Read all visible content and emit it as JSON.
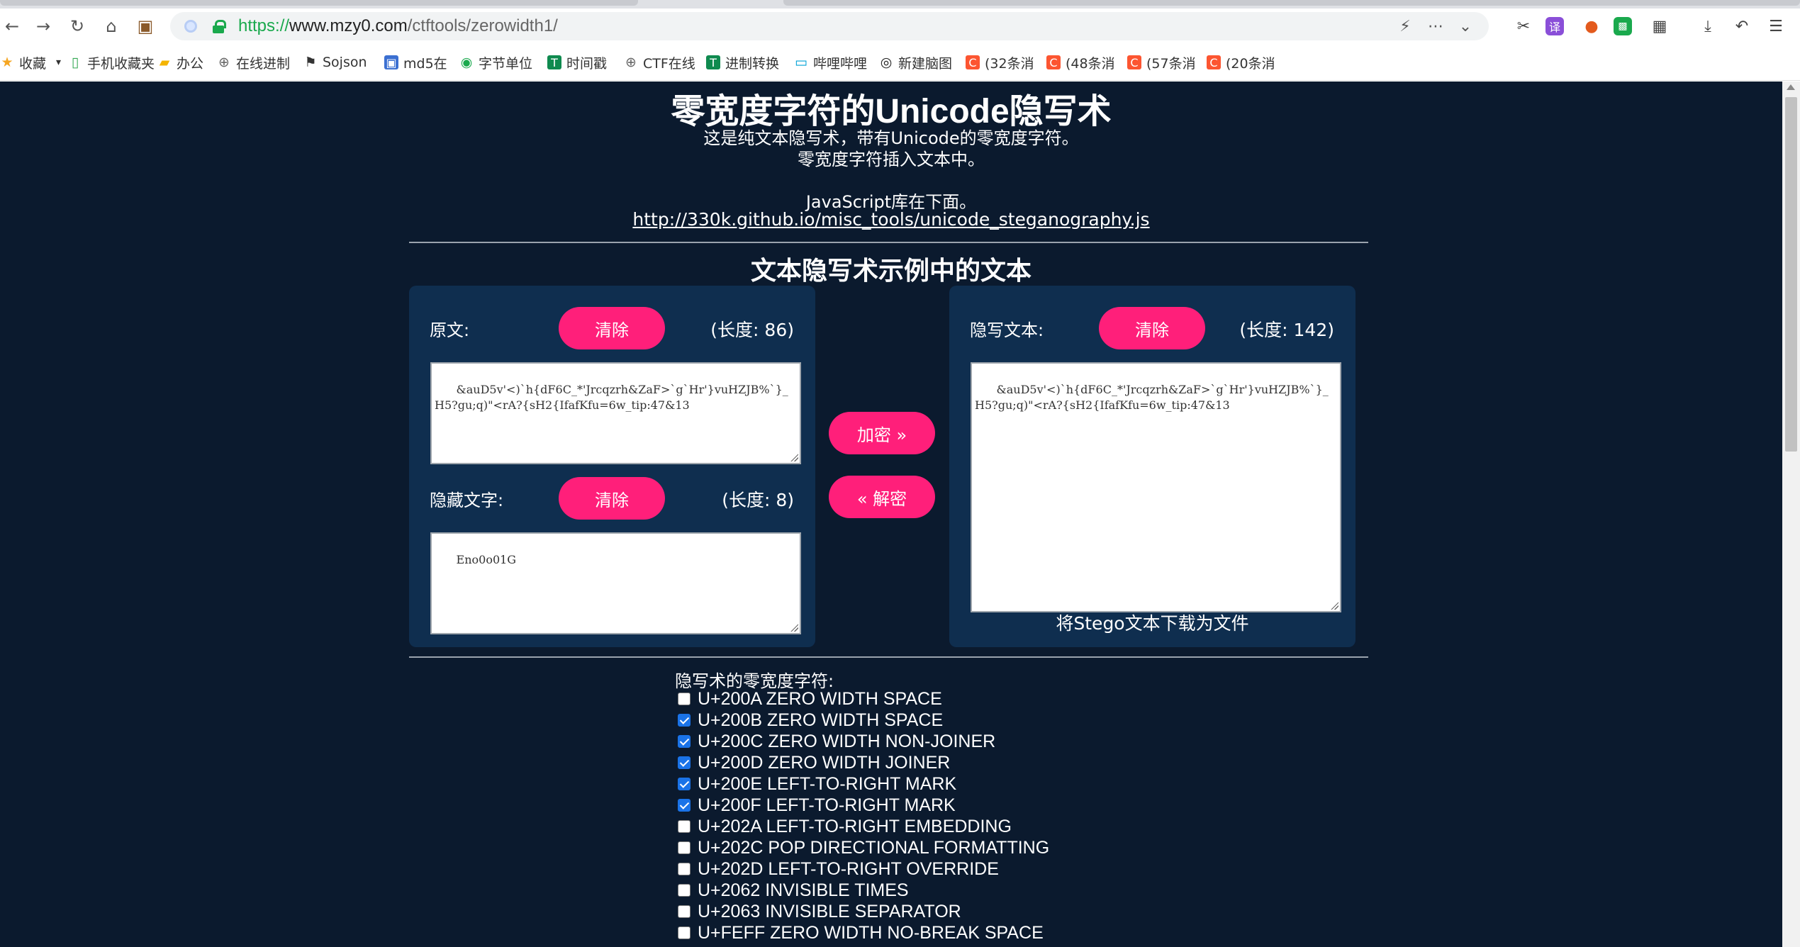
{
  "browser": {
    "url_scheme": "https://",
    "url_host": "www.mzy0.com",
    "url_path": "/ctftools/zerowidth1/",
    "icons": {
      "back": "back-arrow-icon",
      "forward": "forward-arrow-icon",
      "reload": "reload-icon",
      "home": "home-icon",
      "briefcase": "briefcase-icon"
    },
    "bookmarks": [
      {
        "label": "收藏",
        "icon": "star-icon",
        "color": "#f5a623"
      },
      {
        "label": "手机收藏夹",
        "icon": "phone-icon",
        "color": "#34a853"
      },
      {
        "label": "办公",
        "icon": "folder-icon",
        "color": "#f4b400"
      },
      {
        "label": "在线进制",
        "icon": "globe-icon",
        "color": "#666666"
      },
      {
        "label": "Sojson",
        "icon": "sojson-icon",
        "color": "#333333"
      },
      {
        "label": "md5在",
        "icon": "md5-icon",
        "color": "#3b6fd1"
      },
      {
        "label": "字节单位",
        "icon": "byte-icon",
        "color": "#1aa94d"
      },
      {
        "label": "时间戳",
        "icon": "timestamp-icon",
        "color": "#0f8a4f"
      },
      {
        "label": "CTF在线",
        "icon": "globe-icon",
        "color": "#666666"
      },
      {
        "label": "进制转换",
        "icon": "convert-icon",
        "color": "#0f8a4f"
      },
      {
        "label": "哔哩哔哩",
        "icon": "bilibili-icon",
        "color": "#00a1d6"
      },
      {
        "label": "新建脑图",
        "icon": "mindmap-icon",
        "color": "#222222"
      },
      {
        "label": "(32条消",
        "icon": "csdn-icon",
        "color": "#fc5531"
      },
      {
        "label": "(48条消",
        "icon": "csdn-icon",
        "color": "#fc5531"
      },
      {
        "label": "(57条消",
        "icon": "csdn-icon",
        "color": "#fc5531"
      },
      {
        "label": "(20条消",
        "icon": "csdn-icon",
        "color": "#fc5531"
      }
    ]
  },
  "page": {
    "title": "零宽度字符的Unicode隐写术",
    "intro_line1": "这是纯文本隐写术，带有Unicode的零宽度字符。",
    "intro_line2": "零宽度字符插入文本中。",
    "intro_line3": "JavaScript库在下面。",
    "lib_link": "http://330k.github.io/misc_tools/unicode_steganography.js",
    "section_title": "文本隐写术示例中的文本",
    "colors": {
      "background": "#0b1a2e",
      "panel": "#0f2e4f",
      "accent": "#ff1f7a"
    }
  },
  "left_panel": {
    "original_label": "原文:",
    "clear_label": "清除",
    "original_length": "(长度: 86)",
    "original_text": "&auD5v'<)`h{dF6C_*'Jrcqzrh&ZaF>`g`Hr'}vuHZJB%`}_H5?gu;q)\"<rA?{sH2{IfafKfu=6w_tip:47&13",
    "hidden_label": "隐藏文字:",
    "hidden_length": "(长度: 8)",
    "hidden_text": "Eno0o01G"
  },
  "middle": {
    "encode_label": "加密 »",
    "decode_label": "« 解密"
  },
  "right_panel": {
    "stego_label": "隐写文本:",
    "clear_label": "清除",
    "stego_length": "(长度: 142)",
    "stego_text": "&auD5v'<)`h{dF6C_*'Jrcqzrh&ZaF>`g`Hr'}vuHZJB%`}_H5?gu;q)\"<rA?{sH2{IfafKfu=6w_tip:47&13",
    "download_label": "将Stego文本下载为文件"
  },
  "zero_width": {
    "title": "隐写术的零宽度字符:",
    "options": [
      {
        "label": "U+200A ZERO WIDTH SPACE",
        "checked": false
      },
      {
        "label": "U+200B ZERO WIDTH SPACE",
        "checked": true
      },
      {
        "label": "U+200C ZERO WIDTH NON-JOINER",
        "checked": true
      },
      {
        "label": "U+200D ZERO WIDTH JOINER",
        "checked": true
      },
      {
        "label": "U+200E LEFT-TO-RIGHT MARK",
        "checked": true
      },
      {
        "label": "U+200F LEFT-TO-RIGHT MARK",
        "checked": true
      },
      {
        "label": "U+202A LEFT-TO-RIGHT EMBEDDING",
        "checked": false
      },
      {
        "label": "U+202C POP DIRECTIONAL FORMATTING",
        "checked": false
      },
      {
        "label": "U+202D LEFT-TO-RIGHT OVERRIDE",
        "checked": false
      },
      {
        "label": "U+2062 INVISIBLE TIMES",
        "checked": false
      },
      {
        "label": "U+2063 INVISIBLE SEPARATOR",
        "checked": false
      },
      {
        "label": "U+FEFF ZERO WIDTH NO-BREAK SPACE",
        "checked": false
      }
    ]
  }
}
